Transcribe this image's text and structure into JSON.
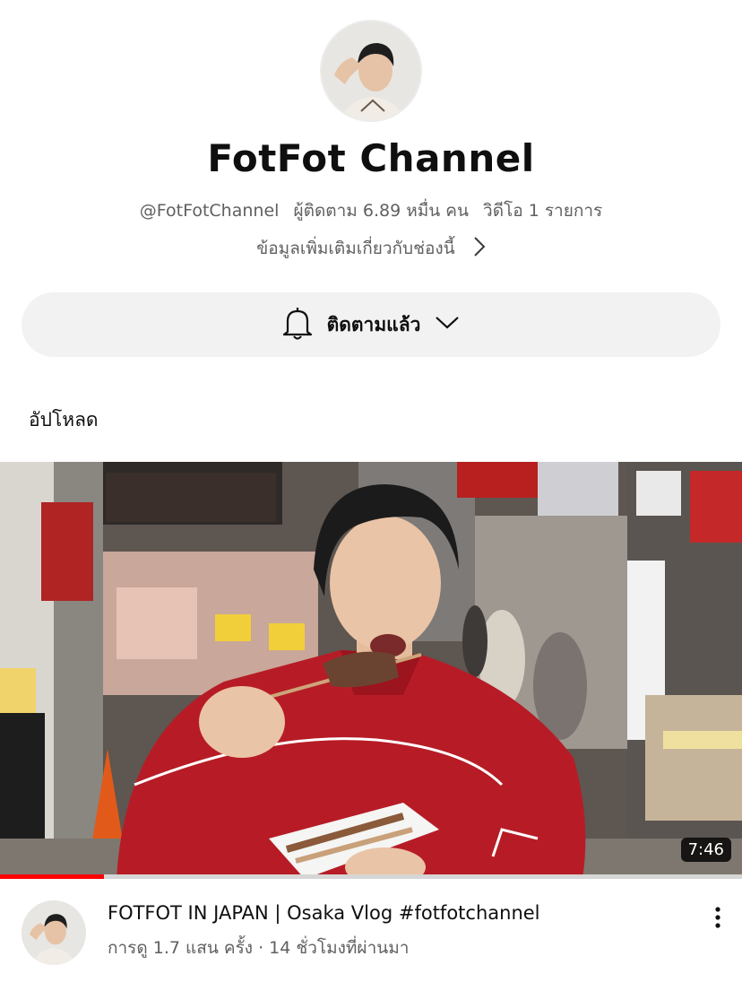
{
  "channel": {
    "name": "FotFot Channel",
    "handle": "@FotFotChannel",
    "subscribers": "ผู้ติดตาม 6.89 หมื่น คน",
    "videos": "วิดีโอ 1 รายการ",
    "more_info": "ข้อมูลเพิ่มเติมเกี่ยวกับช่องนี้"
  },
  "subscribe": {
    "label": "ติดตามแล้ว",
    "icon": "bell-icon"
  },
  "section": {
    "uploads_label": "อัปโหลด"
  },
  "video": {
    "title": "FOTFOT IN JAPAN | Osaka Vlog #fotfotchannel",
    "views": "การดู 1.7 แสน ครั้ง",
    "separator": "·",
    "age": "14 ชั่วโมงที่ผ่านมา",
    "duration": "7:46",
    "watch_progress": 0.14
  },
  "colors": {
    "progress": "#ff0000",
    "button_bg": "#f2f2f2",
    "secondary_text": "#606060"
  }
}
